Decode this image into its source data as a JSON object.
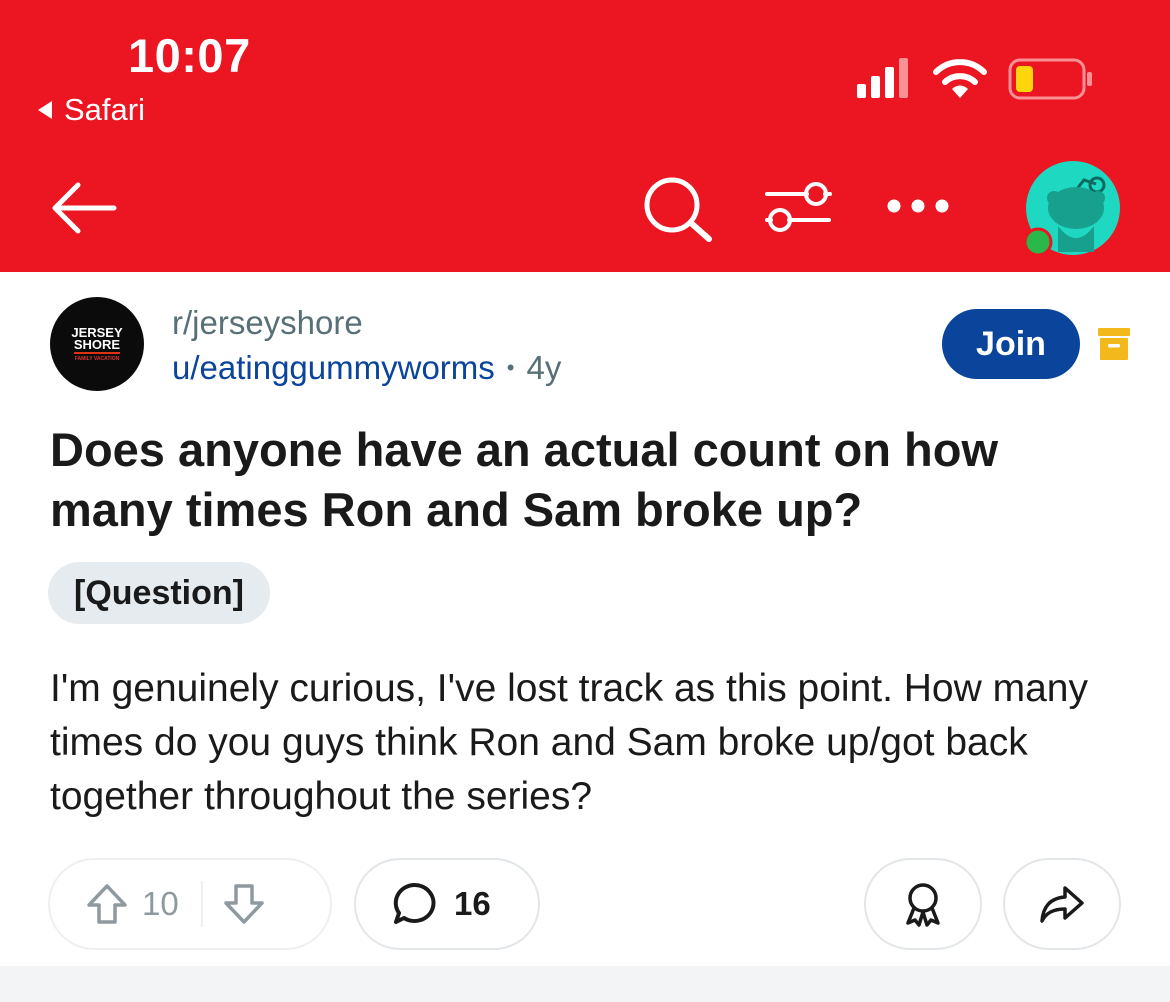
{
  "status_bar": {
    "time": "10:07",
    "back_app": "Safari"
  },
  "post": {
    "subreddit": "r/jerseyshore",
    "subreddit_logo_text": [
      "JERSEY",
      "SHORE",
      "FAMILY VACATION"
    ],
    "author": "u/eatinggummyworms",
    "separator": "•",
    "age": "4y",
    "join_label": "Join",
    "title": "Does anyone have an actual count on how many times Ron and Sam broke up?",
    "flair": "[Question]",
    "body": "I'm genuinely curious, I've lost track as this point. How many times do you guys think Ron and Sam broke up/got back together throughout the series?",
    "score": "10",
    "comments": "16"
  },
  "icons": [
    "back-arrow-icon",
    "search-icon",
    "filter-icon",
    "more-icon",
    "user-avatar-icon",
    "archive-icon",
    "upvote-icon",
    "downvote-icon",
    "comment-icon",
    "award-icon",
    "share-icon"
  ],
  "colors": {
    "header_bg": "#ec1522",
    "join_bg": "#0a449b",
    "author_link": "#0a449b",
    "flair_bg": "#e5ebee",
    "avatar_bg": "#1ed8c2",
    "online_dot": "#2bb84b",
    "archive_yellow": "#f3b81b"
  }
}
